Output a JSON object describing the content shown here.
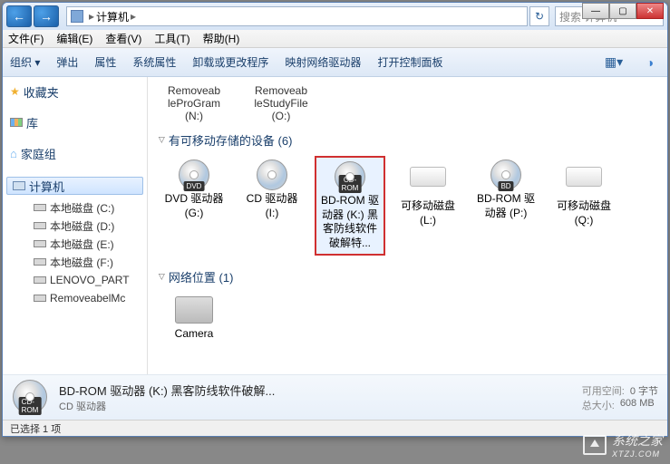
{
  "titlebar": {
    "path_root_icon": "computer",
    "path_segments": [
      "计算机"
    ],
    "search_placeholder": "搜索 计算机"
  },
  "window_controls": {
    "min": "—",
    "max": "▢",
    "close": "✕"
  },
  "menubar": [
    "文件(F)",
    "编辑(E)",
    "查看(V)",
    "工具(T)",
    "帮助(H)"
  ],
  "toolbar": {
    "items": [
      "组织 ▾",
      "弹出",
      "属性",
      "系统属性",
      "卸载或更改程序",
      "映射网络驱动器",
      "打开控制面板"
    ]
  },
  "sidebar": {
    "favorites": "收藏夹",
    "libraries": "库",
    "homegroup": "家庭组",
    "computer": "计算机",
    "drives": [
      "本地磁盘 (C:)",
      "本地磁盘 (D:)",
      "本地磁盘 (E:)",
      "本地磁盘 (F:)",
      "LENOVO_PART",
      "RemoveabelMc"
    ]
  },
  "content": {
    "top_folders": [
      {
        "line1": "Removeab",
        "line2": "leProGram",
        "line3": "(N:)"
      },
      {
        "line1": "Removeab",
        "line2": "leStudyFile",
        "line3": "(O:)"
      }
    ],
    "section_removable": {
      "title": "有可移动存储的设备 (6)"
    },
    "drives": [
      {
        "badge": "DVD",
        "label": "DVD 驱动器 (G:)",
        "type": "disc"
      },
      {
        "badge": "",
        "label": "CD 驱动器 (I:)",
        "type": "disc"
      },
      {
        "badge": "CD-ROM",
        "label": "BD-ROM 驱动器 (K:) 黑客防线软件破解特...",
        "type": "disc",
        "selected": true
      },
      {
        "badge": "",
        "label": "可移动磁盘 (L:)",
        "type": "remdisk"
      },
      {
        "badge": "BD",
        "label": "BD-ROM 驱动器 (P:)",
        "type": "disc"
      },
      {
        "badge": "",
        "label": "可移动磁盘 (Q:)",
        "type": "remdisk"
      }
    ],
    "section_network": {
      "title": "网络位置 (1)"
    },
    "network_items": [
      {
        "label": "Camera"
      }
    ]
  },
  "details": {
    "title": "BD-ROM 驱动器 (K:) 黑客防线软件破解...",
    "subtitle": "CD 驱动器",
    "free_label": "可用空间:",
    "free_value": "0 字节",
    "total_label": "总大小:",
    "total_value": "608 MB"
  },
  "status": "已选择 1 项",
  "watermark": "系统之家",
  "watermark_url": "XTZJ.COM"
}
